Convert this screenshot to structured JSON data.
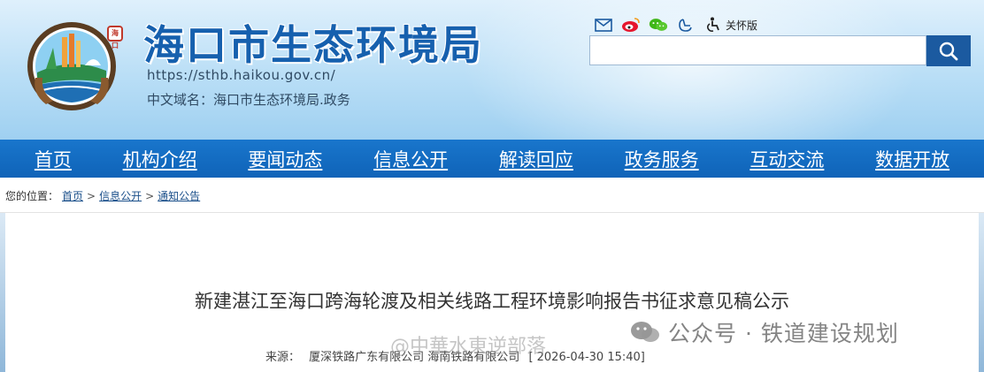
{
  "site": {
    "title": "海口市生态环境局",
    "url": "https://sthb.haikou.gov.cn/",
    "domain": "中文域名：海口市生态环境局.政务",
    "seal_text": "海口"
  },
  "tools": {
    "icons": [
      "mail-icon",
      "weibo-icon",
      "wechat-icon",
      "accessibility-icon",
      "accessible-mode-icon"
    ],
    "care_label": "关怀版"
  },
  "search": {
    "value": "",
    "placeholder": ""
  },
  "nav": {
    "items": [
      "首页",
      "机构介绍",
      "要闻动态",
      "信息公开",
      "解读回应",
      "政务服务",
      "互动交流",
      "数据开放"
    ]
  },
  "breadcrumb": {
    "prefix": "您的位置：",
    "items": [
      "首页",
      "信息公开",
      "通知公告"
    ],
    "separator": ">"
  },
  "article": {
    "title": "新建湛江至海口跨海轮渡及相关线路工程环境影响报告书征求意见稿公示",
    "source_label": "来源：",
    "source": "厦深铁路广东有限公司 海南铁路有限公司",
    "date": "[ 2026-04-30 15:40]"
  },
  "watermark": {
    "text": "公众号 · 铁道建设规划",
    "text2": "@中華水東逆部落"
  },
  "colors": {
    "title_blue": "#1660ae",
    "nav_blue": "#1976cc",
    "search_button": "#1b5aa0"
  }
}
